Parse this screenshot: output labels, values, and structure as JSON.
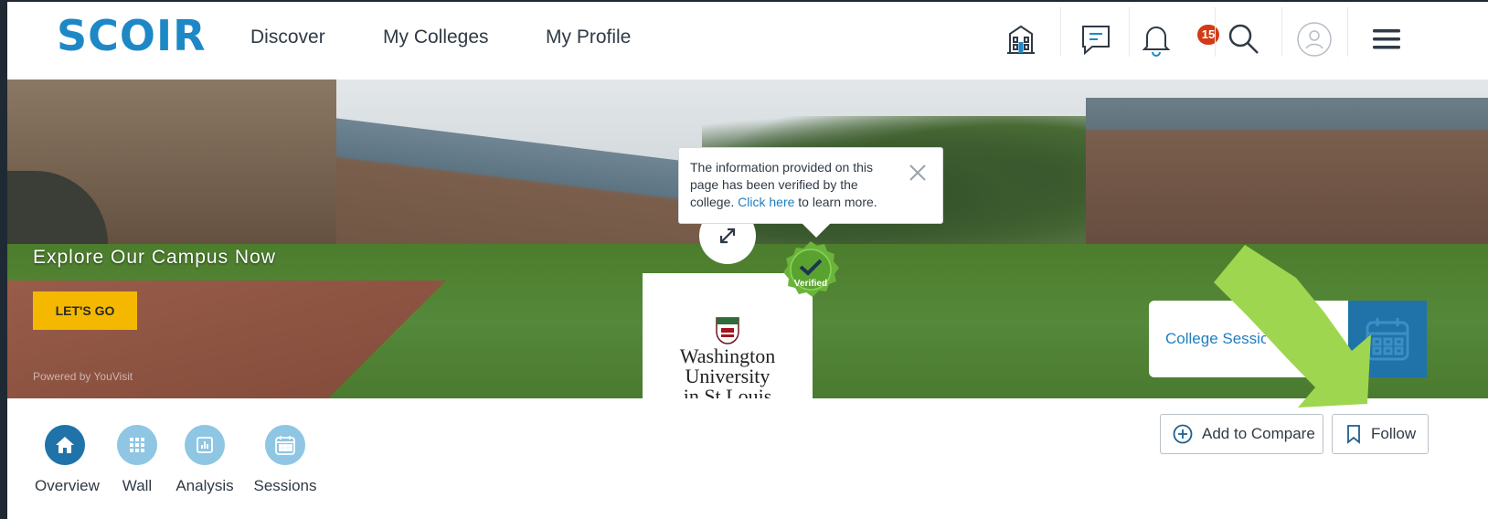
{
  "brand": {
    "name": "SCOIR",
    "color": "#1e88c6"
  },
  "nav": {
    "links": [
      "Discover",
      "My Colleges",
      "My Profile"
    ],
    "icons": [
      "building-icon",
      "chat-icon",
      "bell-icon",
      "search-icon",
      "user-avatar-icon",
      "menu-icon"
    ],
    "notification_count": "15"
  },
  "hero": {
    "explore_text": "Explore Our Campus Now",
    "cta_label": "LET'S GO",
    "powered_by": "Powered by YouVisit",
    "tooltip": {
      "text_before": "The information provided on this page has been verified by the college.",
      "link_text": "Click here",
      "text_after": "to learn more."
    },
    "verified_label": "Verified",
    "college_logo_lines": [
      "Washington",
      "University",
      "in St.Louis"
    ],
    "college_session_label": "College Sessions"
  },
  "tabs": [
    {
      "label": "Overview",
      "icon": "home-icon",
      "active": true
    },
    {
      "label": "Wall",
      "icon": "grid-icon",
      "active": false
    },
    {
      "label": "Analysis",
      "icon": "bar-chart-icon",
      "active": false
    },
    {
      "label": "Sessions",
      "icon": "calendar-icon",
      "active": false
    }
  ],
  "actions": {
    "compare_label": "Add to Compare",
    "follow_label": "Follow"
  },
  "colors": {
    "accent": "#1e7fc0",
    "cta": "#f5b800",
    "badge": "#d23b16",
    "verified": "#6ab43a",
    "annotation_arrow": "#9ed64f"
  }
}
